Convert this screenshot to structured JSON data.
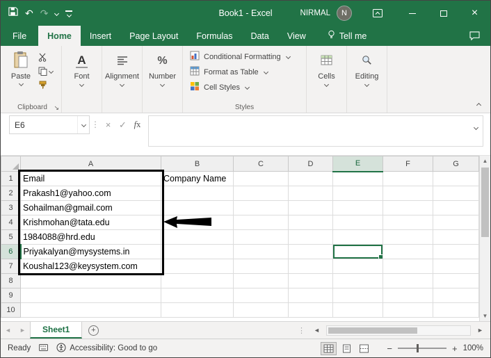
{
  "titlebar": {
    "title": "Book1 - Excel",
    "user_name": "NIRMAL",
    "avatar_initial": "N"
  },
  "tabs": {
    "items": [
      "File",
      "Home",
      "Insert",
      "Page Layout",
      "Formulas",
      "Data",
      "View"
    ],
    "active": "Home",
    "tell_me": "Tell me"
  },
  "ribbon": {
    "paste": "Paste",
    "groups": {
      "clipboard": "Clipboard",
      "font": "Font",
      "alignment": "Alignment",
      "number": "Number",
      "styles": "Styles",
      "cells": "Cells",
      "editing": "Editing"
    },
    "styles_items": [
      "Conditional Formatting",
      "Format as Table",
      "Cell Styles"
    ]
  },
  "formula_bar": {
    "name_box": "E6",
    "formula": ""
  },
  "sheet": {
    "columns": [
      "A",
      "B",
      "C",
      "D",
      "E",
      "F",
      "G"
    ],
    "rows": [
      "1",
      "2",
      "3",
      "4",
      "5",
      "6",
      "7",
      "8",
      "9",
      "10"
    ],
    "cells": {
      "A1": "Email",
      "B1": "Company Name",
      "A2": "Prakash1@yahoo.com",
      "A3": "Sohailman@gmail.com",
      "A4": "Krishmohan@tata.edu",
      "A5": "1984088@hrd.edu",
      "A6": "Priyakalyan@mysystems.in",
      "A7": "Koushal123@keysystem.com"
    },
    "selected_cell": "E6"
  },
  "sheet_bar": {
    "active_sheet": "Sheet1"
  },
  "status_bar": {
    "mode": "Ready",
    "accessibility": "Accessibility: Good to go",
    "zoom_level": "100%"
  },
  "colors": {
    "excel_green": "#217346",
    "annotation_black": "#000000"
  }
}
